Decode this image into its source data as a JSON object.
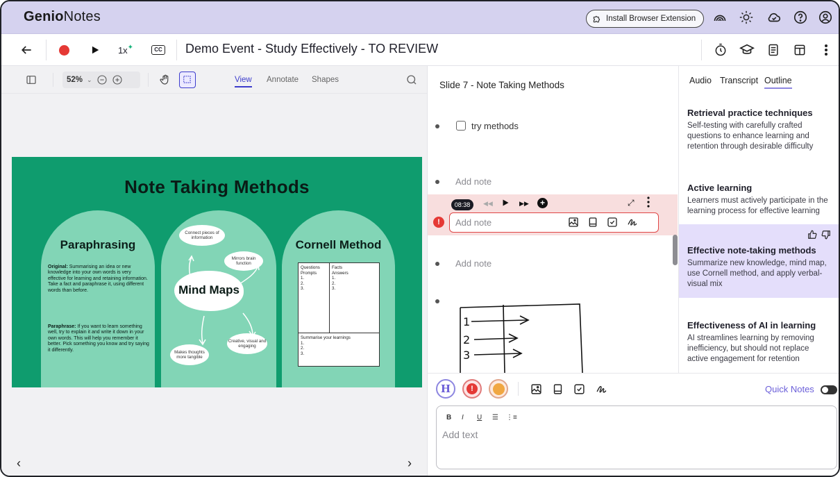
{
  "app": {
    "logo_bold": "Genio",
    "logo_light": "Notes"
  },
  "topbar": {
    "extension_label": "Install Browser Extension"
  },
  "toolbar": {
    "speed_label": "1x",
    "document_title": "Demo Event - Study Effectively - TO REVIEW",
    "cc_label": "CC"
  },
  "viewer": {
    "zoom": "52%",
    "tabs": [
      {
        "label": "View",
        "active": true
      },
      {
        "label": "Annotate",
        "active": false
      },
      {
        "label": "Shapes",
        "active": false
      }
    ]
  },
  "slide": {
    "title": "Note Taking Methods",
    "paraphrasing": {
      "heading": "Paraphrasing",
      "original_label": "Original:",
      "original_text": "Summarising an idea or new knowledge into your own words is very effective for learning and retaining information. Take a fact and paraphrase it, using different words than before.",
      "paraphrase_label": "Paraphrase:",
      "paraphrase_text": "If you want to learn something well, try to explain it and write it down in your own words.  This will help you remember it better.  Pick something you know and try saying it differently."
    },
    "mindmaps": {
      "heading": "Mind Maps",
      "clouds": [
        "Connect pieces of information",
        "Mirrors brain function",
        "Makes thoughts more tangible",
        "Creative, visual and engaging"
      ]
    },
    "cornell": {
      "heading": "Cornell Method",
      "left_col": [
        "Questions",
        "Prompts",
        "1.",
        "2.",
        "3."
      ],
      "right_col": [
        "Facts",
        "Answers",
        "1.",
        "2.",
        "3."
      ],
      "summary": [
        "Summarise your learnings",
        "1.",
        "2.",
        "3."
      ]
    }
  },
  "notes": {
    "slide_label": "Slide 7 - Note Taking Methods",
    "items": [
      {
        "text": "try methods",
        "type": "checkbox"
      },
      {
        "text": "Add note",
        "type": "placeholder"
      },
      {
        "text": "Add note",
        "type": "placeholder"
      }
    ],
    "recording": {
      "time": "08:38",
      "input_placeholder": "Add note"
    },
    "handwriting_lines": [
      "1",
      "2",
      "3"
    ]
  },
  "sidebar": {
    "tabs": [
      {
        "label": "Audio",
        "active": false
      },
      {
        "label": "Transcript",
        "active": false
      },
      {
        "label": "Outline",
        "active": true
      }
    ],
    "outline": [
      {
        "title": "Retrieval practice techniques",
        "body": "Self-testing with carefully crafted questions to enhance learning and retention through desirable difficulty"
      },
      {
        "title": "Active learning",
        "body": "Learners must actively participate in the learning process for effective learning"
      },
      {
        "title": "Effective note-taking methods",
        "body": "Summarize new knowledge, mind map, use Cornell method, and apply verbal-visual mix",
        "highlighted": true
      },
      {
        "title": "Effectiveness of AI in learning",
        "body": "AI streamlines learning by removing inefficiency, but should not replace active engagement for retention"
      }
    ]
  },
  "editor": {
    "quick_notes_label": "Quick Notes",
    "placeholder": "Add text",
    "format_buttons": [
      "B",
      "I",
      "U"
    ],
    "heading_badge": "H"
  },
  "colors": {
    "brand_bar": "#d5d2ef",
    "accent": "#3c3ccc",
    "record": "#e53935",
    "slide_green": "#0f9c6e",
    "arch_green": "#82d5b6",
    "highlight": "#e4defb"
  },
  "icons": [
    "back-arrow-icon",
    "record-icon",
    "play-icon",
    "captions-icon",
    "timer-icon",
    "graduation-cap-icon",
    "document-icon",
    "layout-icon",
    "more-icon",
    "sidebar-icon",
    "zoom-out-icon",
    "zoom-in-icon",
    "hand-icon",
    "select-icon",
    "search-icon",
    "chevron-left-icon",
    "chevron-right-icon",
    "broadcast-icon",
    "sun-icon",
    "cloud-icon",
    "help-icon",
    "account-icon"
  ]
}
